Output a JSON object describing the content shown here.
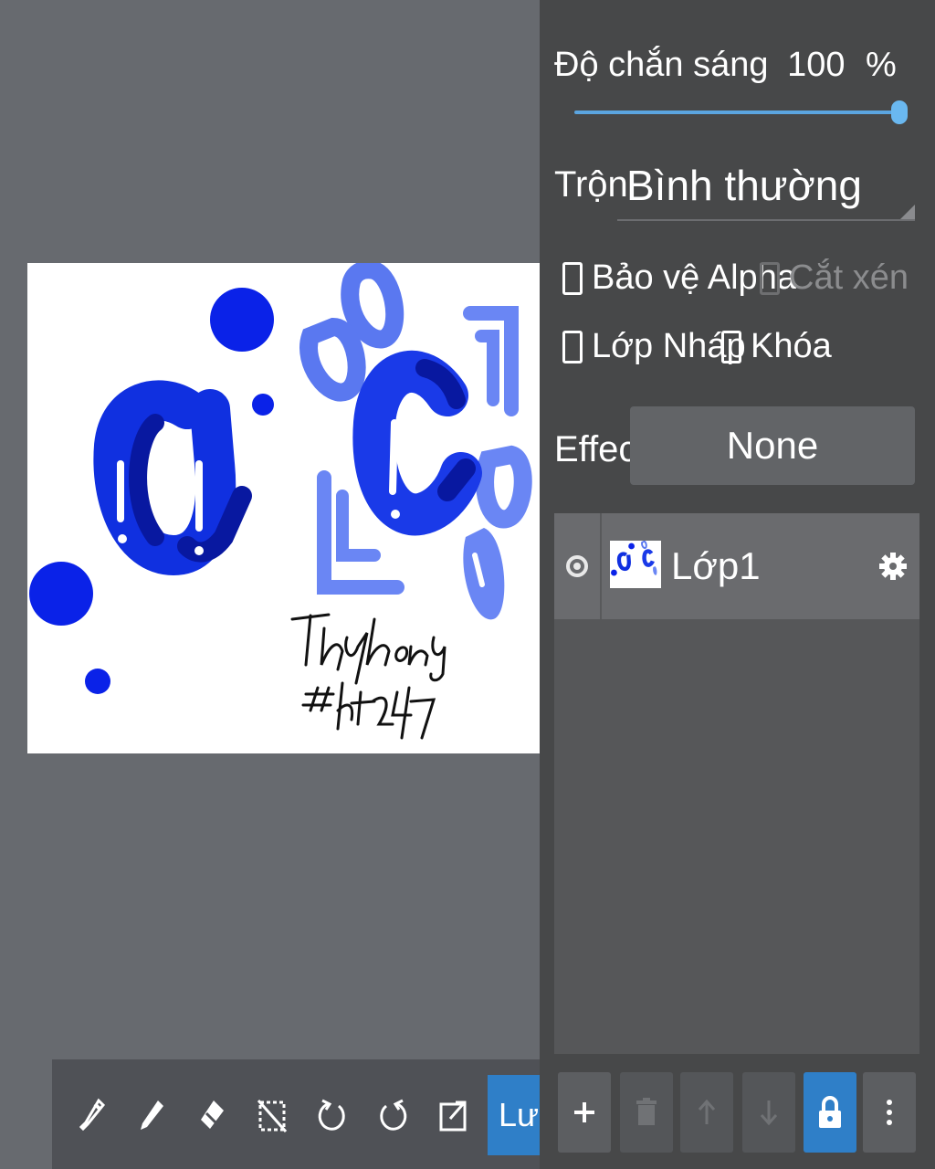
{
  "layer_panel": {
    "opacity_label": "Độ chắn sáng",
    "opacity_value": "100",
    "opacity_unit": "%",
    "opacity_fraction": 1.0,
    "blend_label": "Trộn",
    "blend_value": "Bình thường",
    "checkboxes": [
      {
        "label": "Bảo vệ Alpha",
        "checked": false,
        "enabled": true
      },
      {
        "label": "Cắt xén",
        "checked": false,
        "enabled": false
      },
      {
        "label": "Lớp Nháp",
        "checked": false,
        "enabled": true
      },
      {
        "label": "Khóa",
        "checked": false,
        "enabled": true
      }
    ],
    "effect_label": "Effect",
    "effect_value": "None",
    "layers": [
      {
        "name": "Lớp1",
        "visible": true
      }
    ]
  },
  "toolbar": {
    "tools": [
      "eyedropper-icon",
      "pencil-icon",
      "eraser-icon",
      "deselect-icon",
      "undo-icon",
      "redo-icon",
      "export-icon"
    ],
    "save_label": "Lưu"
  },
  "layer_actions": [
    "add-layer-icon",
    "delete-layer-icon",
    "move-up-icon",
    "move-down-icon",
    "lock-icon",
    "more-icon"
  ],
  "colors": {
    "accent": "#2f7fc8",
    "panel_bg": "#474849",
    "canvas_bg": "#676a6f"
  }
}
